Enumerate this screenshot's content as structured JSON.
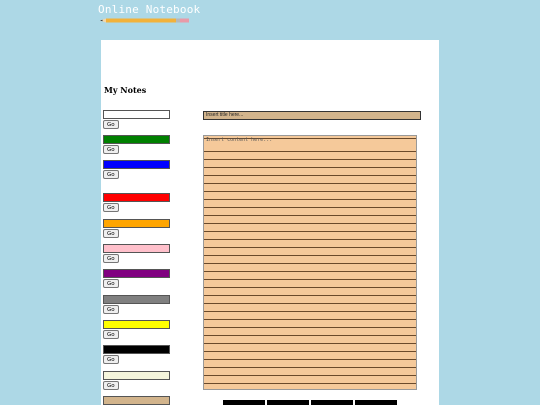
{
  "header": {
    "title": "Online Notebook",
    "pencil_icon": "pencil-icon"
  },
  "notes": {
    "heading": "My Notes",
    "go_label": "Go",
    "colors": [
      {
        "name": "white",
        "hex": "#ffffff"
      },
      {
        "name": "green",
        "hex": "#008000"
      },
      {
        "name": "blue",
        "hex": "#0000ff"
      },
      {
        "name": "red",
        "hex": "#ff0000"
      },
      {
        "name": "orange",
        "hex": "#ffa500"
      },
      {
        "name": "pink",
        "hex": "#ffc0cb"
      },
      {
        "name": "purple",
        "hex": "#800080"
      },
      {
        "name": "gray",
        "hex": "#808080"
      },
      {
        "name": "yellow",
        "hex": "#ffff00"
      },
      {
        "name": "black",
        "hex": "#000000"
      },
      {
        "name": "beige",
        "hex": "#f5f5dc"
      },
      {
        "name": "tan",
        "hex": "#d2b48c"
      }
    ]
  },
  "editor": {
    "title_placeholder": "Insert title here...",
    "content_placeholder": "Insert content here..."
  },
  "colors": {
    "background": "#add8e6",
    "panel": "#ffffff",
    "paper": "#f5c99a",
    "title_field": "#d2b48c"
  }
}
